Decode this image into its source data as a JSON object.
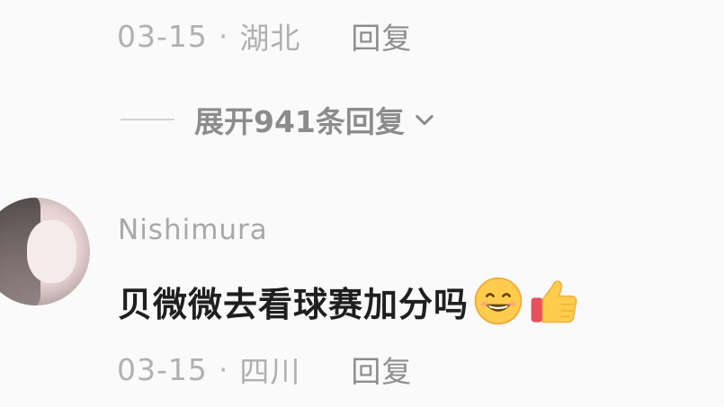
{
  "reply_above": {
    "date": "03-15",
    "separator": "·",
    "location": "湖北",
    "reply_label": "回复"
  },
  "expand": {
    "label": "展开941条回复"
  },
  "comment": {
    "username": "Nishimura",
    "text": "贝微微去看球赛加分吗",
    "emojis": [
      "grinning-face-icon",
      "thumbs-up-icon"
    ],
    "date": "03-15",
    "separator": "·",
    "location": "四川",
    "reply_label": "回复"
  }
}
